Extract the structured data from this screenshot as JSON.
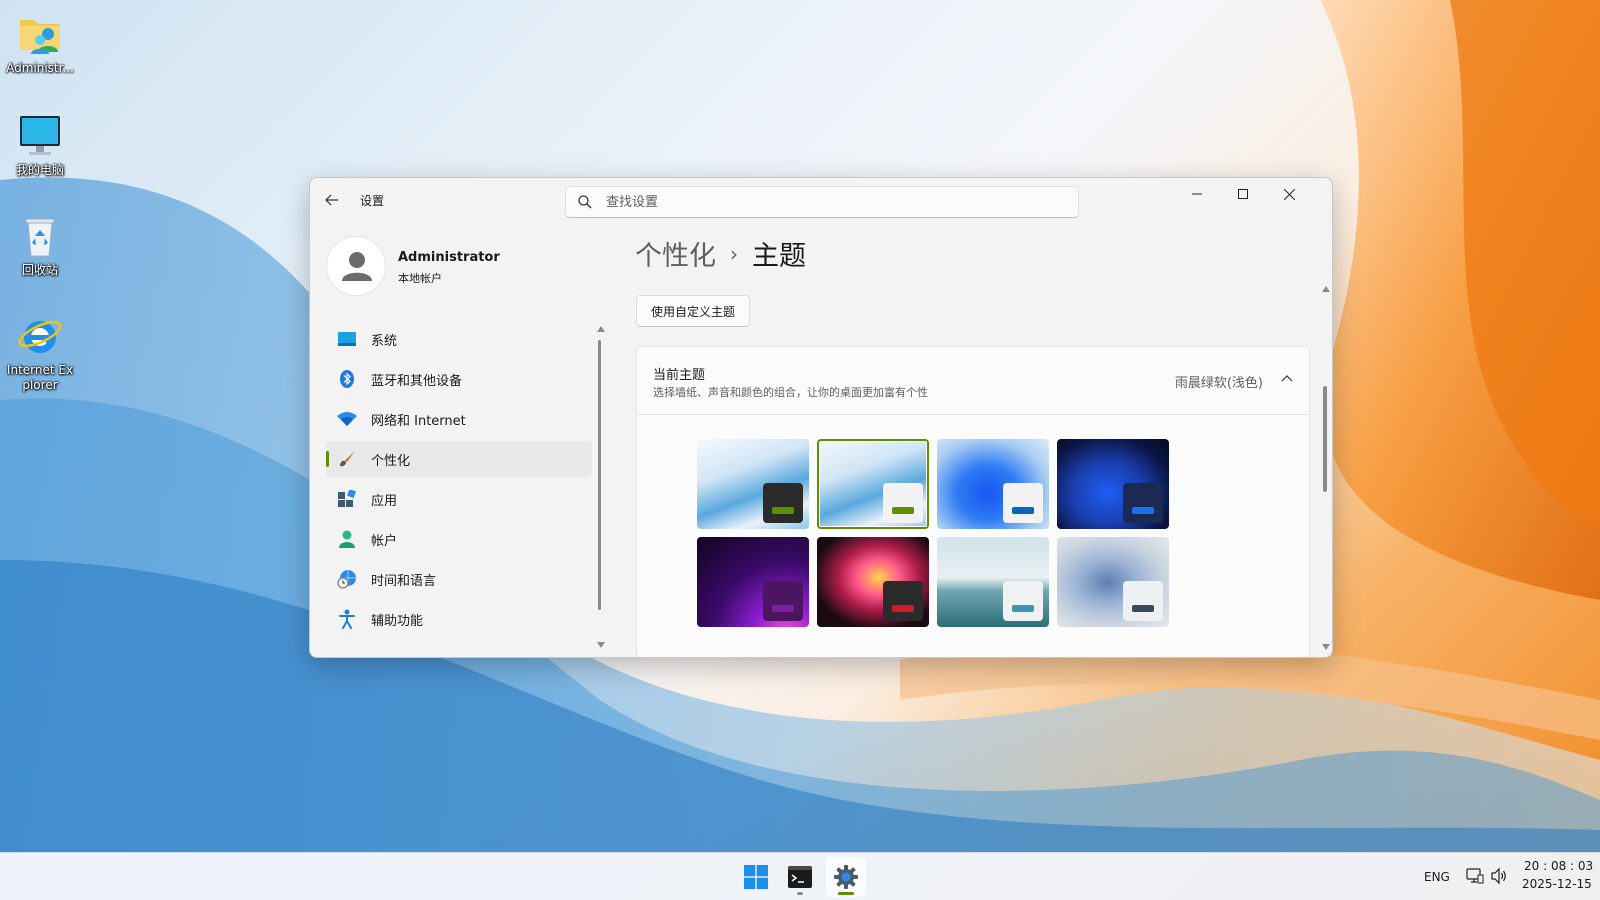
{
  "desktop": {
    "icons": [
      {
        "label": "Administr...",
        "icon": "user-folder-icon"
      },
      {
        "label": "我的电脑",
        "icon": "computer-icon"
      },
      {
        "label": "回收站",
        "icon": "recycle-bin-icon"
      },
      {
        "label": "Internet Explorer",
        "icon": "internet-explorer-icon"
      }
    ]
  },
  "window": {
    "app_title": "设置",
    "search_placeholder": "查找设置",
    "profile": {
      "name": "Administrator",
      "type": "本地帐户"
    },
    "nav": [
      {
        "label": "系统",
        "icon": "system-icon"
      },
      {
        "label": "蓝牙和其他设备",
        "icon": "bluetooth-icon"
      },
      {
        "label": "网络和 Internet",
        "icon": "wifi-icon"
      },
      {
        "label": "个性化",
        "icon": "brush-icon",
        "active": true
      },
      {
        "label": "应用",
        "icon": "apps-icon"
      },
      {
        "label": "帐户",
        "icon": "account-icon"
      },
      {
        "label": "时间和语言",
        "icon": "globe-clock-icon"
      },
      {
        "label": "辅助功能",
        "icon": "accessibility-icon"
      }
    ],
    "breadcrumb": {
      "parent": "个性化",
      "separator": "›",
      "current": "主题"
    },
    "custom_theme_button": "使用自定义主题",
    "current_theme": {
      "title": "当前主题",
      "subtitle": "选择墙纸、声音和颜色的组合，让你的桌面更加富有个性",
      "value": "雨晨绿软(浅色)"
    },
    "themes": [
      {
        "name": "theme-bloom-light-dark",
        "bar": "#5e8f00",
        "swatch": "#2b2b2b"
      },
      {
        "name": "theme-bloom-light-selected",
        "bar": "#5e8f00",
        "swatch": "#f2f2f2",
        "selected": true
      },
      {
        "name": "theme-windows-light",
        "bar": "#0067c0",
        "swatch": "#f2f2f2"
      },
      {
        "name": "theme-windows-dark",
        "bar": "#1a73e8",
        "swatch": "#1b2a55"
      },
      {
        "name": "theme-glow",
        "bar": "#7a1fa0",
        "swatch": "#4c1560"
      },
      {
        "name": "theme-captured-motion",
        "bar": "#d11a2a",
        "swatch": "#2b2b2b"
      },
      {
        "name": "theme-sunrise",
        "bar": "#3d95b5",
        "swatch": "#eef2f3"
      },
      {
        "name": "theme-flow",
        "bar": "#3b4a5a",
        "swatch": "#eef1f4"
      }
    ]
  },
  "taskbar": {
    "apps": [
      {
        "name": "start-button",
        "icon": "windows-icon"
      },
      {
        "name": "terminal-button",
        "icon": "terminal-icon"
      },
      {
        "name": "settings-button",
        "icon": "gear-icon",
        "active": true
      }
    ],
    "language": "ENG",
    "time": "20 : 08 : 03",
    "date": "2025-12-15"
  }
}
